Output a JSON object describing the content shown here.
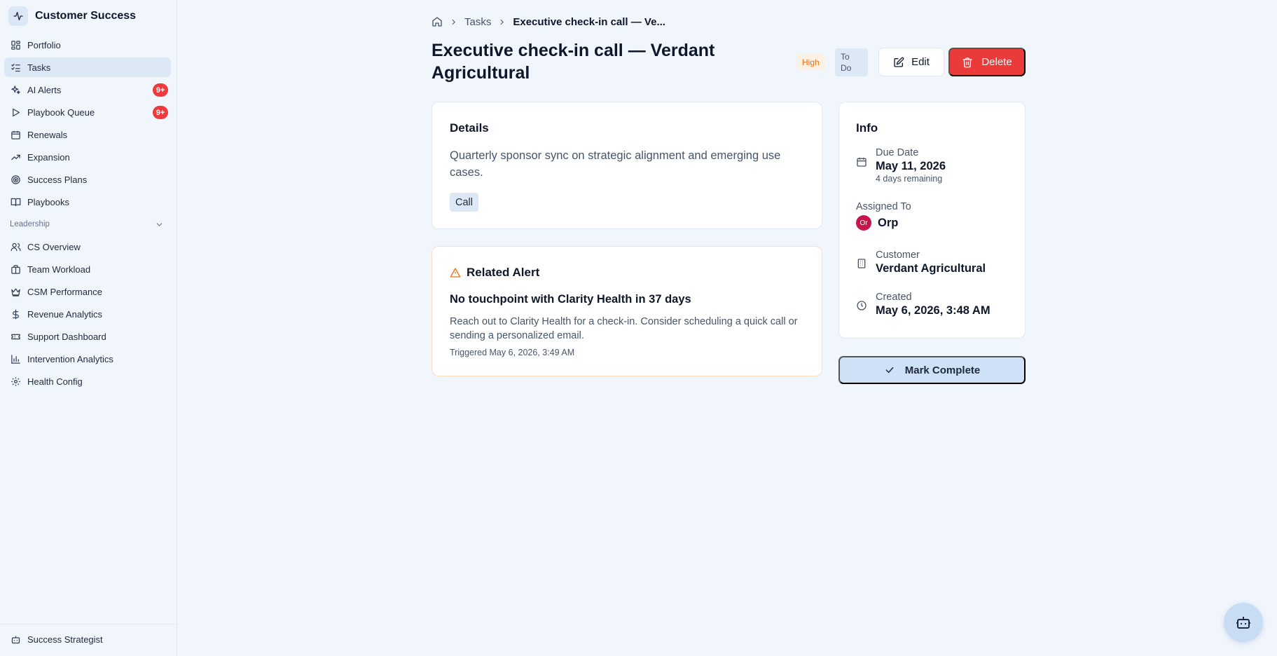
{
  "brand": {
    "name": "Customer Success"
  },
  "nav": {
    "items": [
      {
        "label": "Portfolio",
        "icon": "grid-icon"
      },
      {
        "label": "Tasks",
        "icon": "list-checks-icon"
      },
      {
        "label": "AI Alerts",
        "icon": "sparkles-icon",
        "badge": "9+"
      },
      {
        "label": "Playbook Queue",
        "icon": "play-icon",
        "badge": "9+"
      },
      {
        "label": "Renewals",
        "icon": "calendar-icon"
      },
      {
        "label": "Expansion",
        "icon": "trending-up-icon"
      },
      {
        "label": "Success Plans",
        "icon": "target-icon"
      },
      {
        "label": "Playbooks",
        "icon": "book-icon"
      }
    ],
    "section_label": "Leadership",
    "leadership_items": [
      {
        "label": "CS Overview",
        "icon": "users-icon"
      },
      {
        "label": "Team Workload",
        "icon": "briefcase-icon"
      },
      {
        "label": "CSM Performance",
        "icon": "crown-icon"
      },
      {
        "label": "Revenue Analytics",
        "icon": "dollar-icon"
      },
      {
        "label": "Support Dashboard",
        "icon": "ticket-icon"
      },
      {
        "label": "Intervention Analytics",
        "icon": "bar-chart-icon"
      },
      {
        "label": "Health Config",
        "icon": "gear-icon"
      }
    ],
    "footer_item": {
      "label": "Success Strategist",
      "icon": "bot-icon"
    }
  },
  "breadcrumb": {
    "section": "Tasks",
    "current": "Executive check-in call — Ve..."
  },
  "task": {
    "title": "Executive check-in call — Verdant Agricultural",
    "priority": "High",
    "status": "To Do",
    "edit_label": "Edit",
    "delete_label": "Delete"
  },
  "details": {
    "title": "Details",
    "description": "Quarterly sponsor sync on strategic alignment and emerging use cases.",
    "type": "Call"
  },
  "related_alert": {
    "heading": "Related Alert",
    "title": "No touchpoint with Clarity Health in 37 days",
    "description": "Reach out to Clarity Health for a check-in. Consider scheduling a quick call or sending a personalized email.",
    "triggered": "Triggered May 6, 2026, 3:49 AM"
  },
  "info": {
    "title": "Info",
    "due_label": "Due Date",
    "due_value": "May 11, 2026",
    "due_remaining": "4 days remaining",
    "assigned_label": "Assigned To",
    "assignee_initials": "Or",
    "assignee_name": "Orp",
    "customer_label": "Customer",
    "customer_value": "Verdant Agricultural",
    "created_label": "Created",
    "created_value": "May 6, 2026, 3:48 AM"
  },
  "actions": {
    "mark_complete": "Mark Complete"
  },
  "colors": {
    "accent": "#dde8f6",
    "danger": "#ea3a3a",
    "priority_high": "#e8731a",
    "avatar": "#c8154b"
  }
}
